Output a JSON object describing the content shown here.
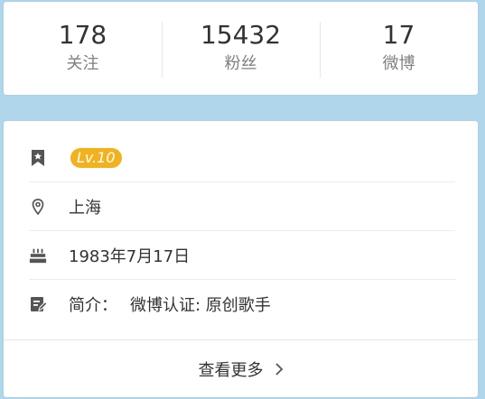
{
  "stats": [
    {
      "value": "178",
      "label": "关注"
    },
    {
      "value": "15432",
      "label": "粉丝"
    },
    {
      "value": "17",
      "label": "微博"
    }
  ],
  "info": {
    "level": "Lv.10",
    "location": "上海",
    "birthday": "1983年7月17日",
    "bio_label": "简介：",
    "bio_text": "微博认证: 原创歌手"
  },
  "more": {
    "label": "查看更多"
  },
  "icons": {
    "level": "bookmark-star-icon",
    "location": "location-pin-icon",
    "birthday": "cake-icon",
    "bio": "edit-note-icon",
    "more": "chevron-right-icon"
  },
  "colors": {
    "background": "#b0d6ec",
    "badge": "#f2b21d"
  }
}
